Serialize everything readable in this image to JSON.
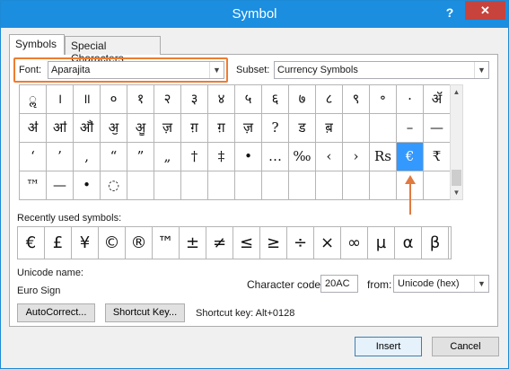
{
  "window": {
    "title": "Symbol",
    "help_label": "?",
    "close_label": "✕"
  },
  "tabs": [
    {
      "label": "Symbols",
      "active": true
    },
    {
      "label": "Special Characters",
      "active": false
    }
  ],
  "font": {
    "label": "Font:",
    "value": "Aparajita"
  },
  "subset": {
    "label": "Subset:",
    "value": "Currency Symbols"
  },
  "grid_rows": [
    [
      "ॢ",
      "।",
      "॥",
      "०",
      "१",
      "२",
      "३",
      "४",
      "५",
      "६",
      "७",
      "८",
      "९",
      "॰",
      "·",
      "ॲ"
    ],
    [
      "ॳ",
      "ॴ",
      "ॵ",
      "ॶ",
      "ॷ",
      "ज़",
      "ग़",
      "ग़",
      "ज़",
      "?",
      "ड",
      "ब़",
      "",
      "",
      "–",
      "—"
    ],
    [
      "‘",
      "’",
      "‚",
      "“",
      "”",
      "„",
      "†",
      "‡",
      "•",
      "…",
      "‰",
      "‹",
      "›",
      "Rs",
      "€",
      "₹"
    ],
    [
      "™",
      "—",
      "•",
      "◌",
      "",
      "",
      "",
      "",
      "",
      "",
      "",
      "",
      "",
      "",
      "",
      ""
    ]
  ],
  "selected_symbol": "€",
  "recent": {
    "label": "Recently used symbols:",
    "symbols": [
      "€",
      "£",
      "¥",
      "©",
      "®",
      "™",
      "±",
      "≠",
      "≤",
      "≥",
      "÷",
      "×",
      "∞",
      "µ",
      "α",
      "β"
    ]
  },
  "unicode": {
    "label": "Unicode name:",
    "value": "Euro Sign"
  },
  "char_code": {
    "label": "Character code:",
    "value": "20AC"
  },
  "from": {
    "label": "from:",
    "value": "Unicode (hex)"
  },
  "buttons": {
    "autocorrect": "AutoCorrect...",
    "shortcut_key": "Shortcut Key...",
    "insert": "Insert",
    "cancel": "Cancel"
  },
  "shortcut_text": "Shortcut key: Alt+0128",
  "colors": {
    "titlebar": "#1b8ee0",
    "close": "#c7433c",
    "selection": "#3399ff",
    "highlight": "#ed7d31",
    "annotation_arrow": "#e07a3f"
  },
  "icons": {
    "arrow": "annotation-arrow-icon",
    "dropdown": "chevron-down-icon",
    "close": "close-icon",
    "help": "help-icon"
  }
}
